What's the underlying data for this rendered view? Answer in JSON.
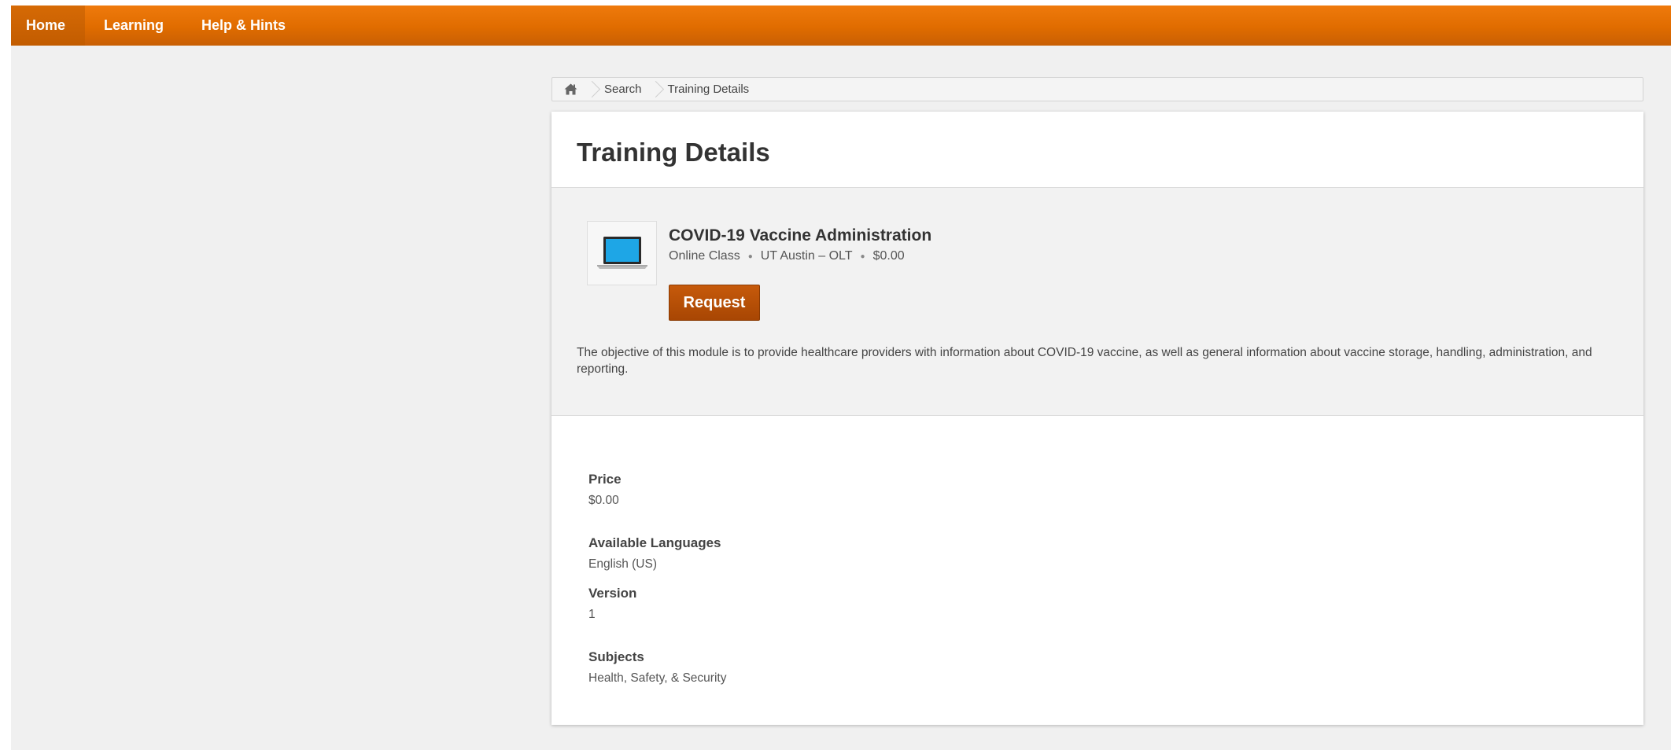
{
  "nav": {
    "items": [
      {
        "label": "Home"
      },
      {
        "label": "Learning"
      },
      {
        "label": "Help & Hints"
      }
    ]
  },
  "breadcrumb": {
    "items": [
      "Search",
      "Training Details"
    ]
  },
  "page": {
    "title": "Training Details"
  },
  "course": {
    "title": "COVID-19 Vaccine Administration",
    "type": "Online Class",
    "provider": "UT Austin – OLT",
    "price": "$0.00",
    "request_label": "Request",
    "description": "The objective of this module is to provide healthcare providers with information about COVID-19 vaccine, as well as general information about vaccine storage, handling, administration, and reporting.",
    "icon": "laptop-icon"
  },
  "details": {
    "price_label": "Price",
    "price_value": "$0.00",
    "languages_label": "Available Languages",
    "languages_value": "English (US)",
    "version_label": "Version",
    "version_value": "1",
    "subjects_label": "Subjects",
    "subjects_value": "Health, Safety, & Security"
  },
  "colors": {
    "nav_orange": "#e06c00",
    "button_brown": "#b04d06",
    "screen_blue": "#1ea6e6"
  }
}
